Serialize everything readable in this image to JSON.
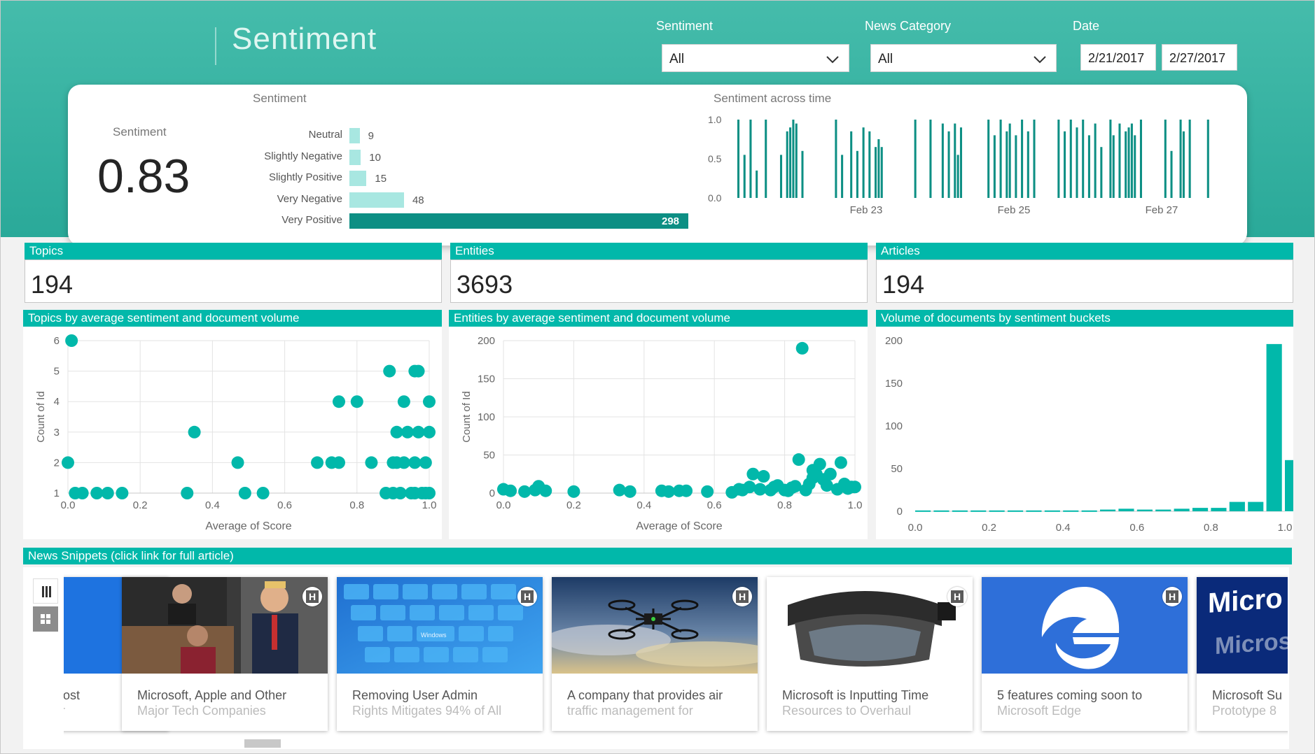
{
  "page": {
    "title": "Sentiment"
  },
  "filters": {
    "sentiment": {
      "label": "Sentiment",
      "value": "All"
    },
    "category": {
      "label": "News Category",
      "value": "All"
    },
    "date": {
      "label": "Date",
      "start": "2/21/2017",
      "end": "2/27/2017"
    }
  },
  "kpi": {
    "sentiment_label": "Sentiment",
    "sentiment_value": "0.83"
  },
  "colors": {
    "teal": "#01b8aa",
    "dark_teal": "#0d8f84",
    "light_teal": "#a8e7e1",
    "header": "#35b3a2"
  },
  "tiles": [
    {
      "title": "Topics",
      "value": "194"
    },
    {
      "title": "Entities",
      "value": "3693"
    },
    {
      "title": "Articles",
      "value": "194"
    }
  ],
  "section_titles": {
    "topics_scatter": "Topics by average sentiment and document volume",
    "entities_scatter": "Entities by average sentiment and document volume",
    "volume_hist": "Volume of documents by sentiment buckets",
    "news": "News Snippets (click link for full article)"
  },
  "chart_data": [
    {
      "type": "bar",
      "orientation": "horizontal",
      "title": "Sentiment",
      "categories": [
        "Neutral",
        "Slightly Negative",
        "Slightly Positive",
        "Very Negative",
        "Very Positive"
      ],
      "values": [
        9,
        10,
        15,
        48,
        298
      ],
      "data_labels": [
        "9",
        "10",
        "15",
        "48",
        "298"
      ]
    },
    {
      "type": "bar",
      "title": "Sentiment across time",
      "ylim": [
        0,
        1
      ],
      "y_ticks": [
        "1.0",
        "0.5",
        "0.0"
      ],
      "x_ticks": [
        "Feb 23",
        "Feb 25",
        "Feb 27"
      ],
      "values": [
        1.0,
        0.0,
        0.55,
        0.0,
        1.0,
        0.0,
        0.35,
        0.0,
        0.0,
        1.0,
        0.0,
        0.0,
        0.0,
        0.0,
        0.55,
        0.0,
        0.85,
        0.9,
        1.0,
        0.95,
        0.0,
        0.6,
        0.0,
        0.0,
        0.0,
        0.0,
        0.0,
        0.0,
        0.0,
        0.0,
        0.0,
        0.0,
        1.0,
        0.0,
        0.55,
        0.0,
        0.0,
        0.85,
        0.0,
        0.6,
        0.0,
        0.9,
        0.0,
        0.85,
        0.0,
        0.65,
        0.75,
        0.65,
        0.0,
        0.0,
        0.0,
        0.0,
        0.0,
        0.0,
        0.0,
        0.0,
        0.0,
        0.0,
        1.0,
        0.0,
        0.0,
        0.0,
        0.0,
        1.0,
        0.0,
        0.0,
        0.0,
        0.95,
        0.0,
        0.85,
        0.0,
        0.95,
        0.55,
        0.9,
        0.0,
        0.0,
        0.0,
        0.0,
        0.0,
        0.0,
        0.0,
        0.0,
        1.0,
        0.0,
        0.8,
        0.0,
        1.0,
        0.0,
        0.85,
        0.95,
        0.0,
        0.8,
        0.0,
        1.0,
        0.0,
        0.85,
        0.0,
        1.0,
        0.0,
        0.0,
        0.0,
        0.0,
        0.0,
        0.0,
        0.0,
        1.0,
        0.0,
        0.85,
        0.0,
        1.0,
        0.0,
        0.9,
        0.0,
        1.0,
        0.0,
        0.8,
        0.0,
        0.95,
        0.0,
        0.65,
        0.0,
        0.0,
        1.0,
        0.8,
        0.0,
        0.95,
        0.0,
        0.85,
        0.9,
        0.95,
        0.8,
        0.0,
        1.0,
        0.0,
        0.0,
        0.0,
        0.0,
        0.0,
        0.0,
        0.0,
        1.0,
        0.0,
        0.6,
        0.0,
        0.0,
        1.0,
        0.85,
        0.0,
        1.0,
        0.0,
        0.0,
        0.0,
        0.0,
        0.0,
        1.0,
        0.0,
        0.0,
        0.0,
        0.0,
        0.0,
        0.0,
        0.0,
        0.0,
        0.0,
        0.0,
        0.0,
        0.0,
        0.0,
        0.0,
        0.0,
        0.0,
        0.0,
        0.0,
        0.0,
        0.0,
        0.0,
        0.8,
        0.9,
        0.0,
        1.0
      ]
    },
    {
      "type": "scatter",
      "title": "Topics by average sentiment and document volume",
      "xlabel": "Average of Score",
      "ylabel": "Count of Id",
      "xlim": [
        0,
        1
      ],
      "ylim": [
        1,
        6
      ],
      "x_ticks": [
        "0.0",
        "0.2",
        "0.4",
        "0.6",
        "0.8",
        "1.0"
      ],
      "y_ticks": [
        "1",
        "2",
        "3",
        "4",
        "5",
        "6"
      ],
      "points": [
        [
          0.01,
          6
        ],
        [
          0.0,
          2
        ],
        [
          0.02,
          1
        ],
        [
          0.04,
          1
        ],
        [
          0.08,
          1
        ],
        [
          0.11,
          1
        ],
        [
          0.15,
          1
        ],
        [
          0.33,
          1
        ],
        [
          0.35,
          3
        ],
        [
          0.47,
          2
        ],
        [
          0.49,
          1
        ],
        [
          0.54,
          1
        ],
        [
          0.69,
          2
        ],
        [
          0.73,
          2
        ],
        [
          0.75,
          2
        ],
        [
          0.75,
          4
        ],
        [
          0.8,
          4
        ],
        [
          0.84,
          2
        ],
        [
          0.88,
          1
        ],
        [
          0.89,
          5
        ],
        [
          0.9,
          1
        ],
        [
          0.9,
          2
        ],
        [
          0.91,
          3
        ],
        [
          0.91,
          2
        ],
        [
          0.92,
          1
        ],
        [
          0.93,
          4
        ],
        [
          0.93,
          2
        ],
        [
          0.94,
          3
        ],
        [
          0.95,
          1
        ],
        [
          0.96,
          2
        ],
        [
          0.96,
          1
        ],
        [
          0.96,
          5
        ],
        [
          0.97,
          5
        ],
        [
          0.97,
          3
        ],
        [
          0.98,
          1
        ],
        [
          0.99,
          2
        ],
        [
          0.99,
          1
        ],
        [
          1.0,
          3
        ],
        [
          1.0,
          4
        ],
        [
          1.0,
          1
        ]
      ]
    },
    {
      "type": "scatter",
      "title": "Entities by average sentiment and document volume",
      "xlabel": "Average of Score",
      "ylabel": "Count of Id",
      "xlim": [
        0,
        1
      ],
      "ylim": [
        0,
        200
      ],
      "x_ticks": [
        "0.0",
        "0.2",
        "0.4",
        "0.6",
        "0.8",
        "1.0"
      ],
      "y_ticks": [
        "0",
        "50",
        "100",
        "150",
        "200"
      ],
      "points": [
        [
          0.0,
          5
        ],
        [
          0.02,
          3
        ],
        [
          0.06,
          2
        ],
        [
          0.09,
          4
        ],
        [
          0.1,
          9
        ],
        [
          0.12,
          3
        ],
        [
          0.2,
          2
        ],
        [
          0.33,
          4
        ],
        [
          0.36,
          2
        ],
        [
          0.45,
          3
        ],
        [
          0.47,
          2
        ],
        [
          0.5,
          3
        ],
        [
          0.52,
          3
        ],
        [
          0.58,
          2
        ],
        [
          0.65,
          1
        ],
        [
          0.67,
          5
        ],
        [
          0.68,
          4
        ],
        [
          0.7,
          8
        ],
        [
          0.71,
          25
        ],
        [
          0.73,
          5
        ],
        [
          0.74,
          22
        ],
        [
          0.76,
          4
        ],
        [
          0.77,
          8
        ],
        [
          0.78,
          10
        ],
        [
          0.8,
          4
        ],
        [
          0.81,
          3
        ],
        [
          0.82,
          7
        ],
        [
          0.83,
          9
        ],
        [
          0.84,
          44
        ],
        [
          0.85,
          190
        ],
        [
          0.86,
          4
        ],
        [
          0.87,
          12
        ],
        [
          0.88,
          20
        ],
        [
          0.88,
          30
        ],
        [
          0.89,
          25
        ],
        [
          0.9,
          38
        ],
        [
          0.91,
          18
        ],
        [
          0.92,
          10
        ],
        [
          0.93,
          25
        ],
        [
          0.95,
          5
        ],
        [
          0.96,
          40
        ],
        [
          0.97,
          12
        ],
        [
          0.98,
          6
        ],
        [
          0.99,
          8
        ],
        [
          1.0,
          8
        ]
      ]
    },
    {
      "type": "bar",
      "title": "Volume of documents by sentiment buckets",
      "xlim": [
        0,
        1
      ],
      "ylim": [
        0,
        200
      ],
      "x_ticks": [
        "0.0",
        "0.2",
        "0.4",
        "0.6",
        "0.8",
        "1.0"
      ],
      "y_ticks": [
        "0",
        "50",
        "100",
        "150",
        "200"
      ],
      "bins": [
        0.0,
        0.05,
        0.1,
        0.15,
        0.2,
        0.25,
        0.3,
        0.35,
        0.4,
        0.45,
        0.5,
        0.55,
        0.6,
        0.65,
        0.7,
        0.75,
        0.8,
        0.85,
        0.9,
        0.95,
        1.0
      ],
      "values": [
        1,
        1,
        1,
        1,
        1,
        1,
        1,
        1,
        1,
        1,
        2,
        3,
        2,
        2,
        3,
        4,
        4,
        11,
        11,
        196,
        60
      ]
    }
  ],
  "news": {
    "view_icons": [
      "list-view-icon",
      "grid-view-icon"
    ],
    "cards": [
      {
        "line1": "Cost",
        "line2": "ar",
        "image": "blue-tile"
      },
      {
        "line1": "Microsoft, Apple and Other",
        "line2": "Major Tech Companies",
        "image": "executives-photo"
      },
      {
        "line1": "Removing User Admin",
        "line2": "Rights Mitigates 94% of All",
        "image": "keyboard-photo"
      },
      {
        "line1": "A company that provides air",
        "line2": "traffic management for",
        "image": "drone-photo"
      },
      {
        "line1": "Microsoft is Inputting Time",
        "line2": "Resources to Overhaul",
        "image": "headset-photo"
      },
      {
        "line1": "5 features coming soon to",
        "line2": "Microsoft Edge",
        "image": "edge-logo"
      },
      {
        "line1": "Microsoft Su",
        "line2": "Prototype 8",
        "image": "microsoft-sign"
      }
    ],
    "badge": "H",
    "keyboard_key": "Windows",
    "sign_line1": "Micro",
    "sign_line2": "Microsoft"
  }
}
